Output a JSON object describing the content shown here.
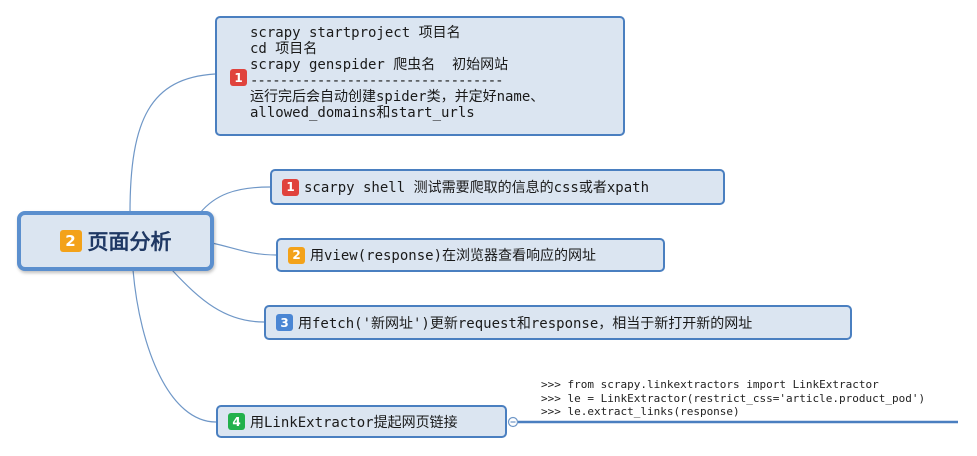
{
  "central": {
    "badge": "2",
    "label": "页面分析"
  },
  "note": {
    "badge": "1",
    "lines": [
      "scrapy startproject 项目名",
      "cd 项目名",
      "scrapy genspider 爬虫名  初始网站",
      "----------------------------------",
      "运行完后会自动创建spider类，并定好name、",
      "allowed_domains和start_urls"
    ]
  },
  "topics": [
    {
      "badge": "1",
      "color": "#e0433d",
      "text": "scarpy shell 测试需要爬取的信息的css或者xpath"
    },
    {
      "badge": "2",
      "color": "#f3a21a",
      "text": "用view(response)在浏览器查看响应的网址"
    },
    {
      "badge": "3",
      "color": "#4a86d4",
      "text": "用fetch('新网址')更新request和response，相当于新打开新的网址"
    },
    {
      "badge": "4",
      "color": "#22b14c",
      "text": "用LinkExtractor提起网页链接"
    }
  ],
  "code": [
    ">>> from scrapy.linkextractors import LinkExtractor",
    ">>> le = LinkExtractor(restrict_css='article.product_pod')",
    ">>> le.extract_links(response)"
  ],
  "colors": {
    "line": "#6f97c7",
    "border": "#4a7fc0",
    "fill": "#dbe5f1"
  }
}
